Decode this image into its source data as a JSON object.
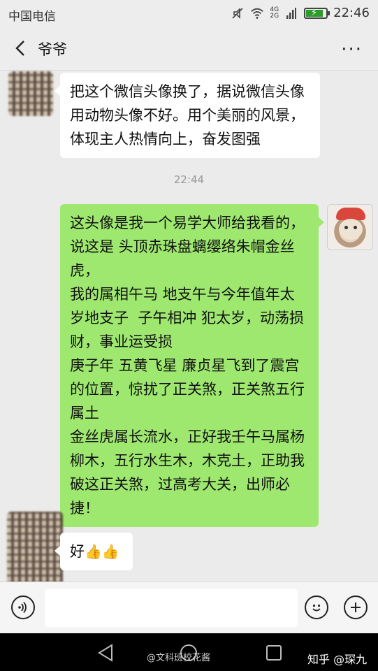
{
  "status_bar": {
    "carrier": "中国电信",
    "network_tag_top": "4G",
    "network_tag_bottom": "2G",
    "battery_level": 0.85,
    "time": "22:46"
  },
  "nav": {
    "title": "爷爷"
  },
  "messages": [
    {
      "side": "left",
      "text": "把这个微信头像换了，据说微信头像用动物头像不好。用个美丽的风景，体现主人热情向上，奋发图强"
    },
    {
      "side": "right",
      "text": "这头像是我一个易学大师给我看的，说这是 头顶赤珠盘螭缨络朱帽金丝虎，\n我的属相午马 地支午与今年值年太岁地支子  子午相冲 犯太岁，动荡损财，事业运受损\n庚子年 五黄飞星 廉贞星飞到了震宫的位置，惊扰了正关煞，正关煞五行属土\n金丝虎属长流水，正好我壬午马属杨柳木，五行水生木，木克土，正助我破这正关煞，过高考大关，出师必捷！"
    },
    {
      "side": "left",
      "text": "好"
    }
  ],
  "timestamp": "22:44",
  "input": {
    "placeholder": ""
  },
  "watermarks": {
    "weibo": "@文科班校花酱",
    "zhihu": "知乎 @琛九"
  },
  "colors": {
    "sent_bubble": "#9fe870",
    "received_bubble": "#ffffff",
    "background": "#ebebeb"
  }
}
